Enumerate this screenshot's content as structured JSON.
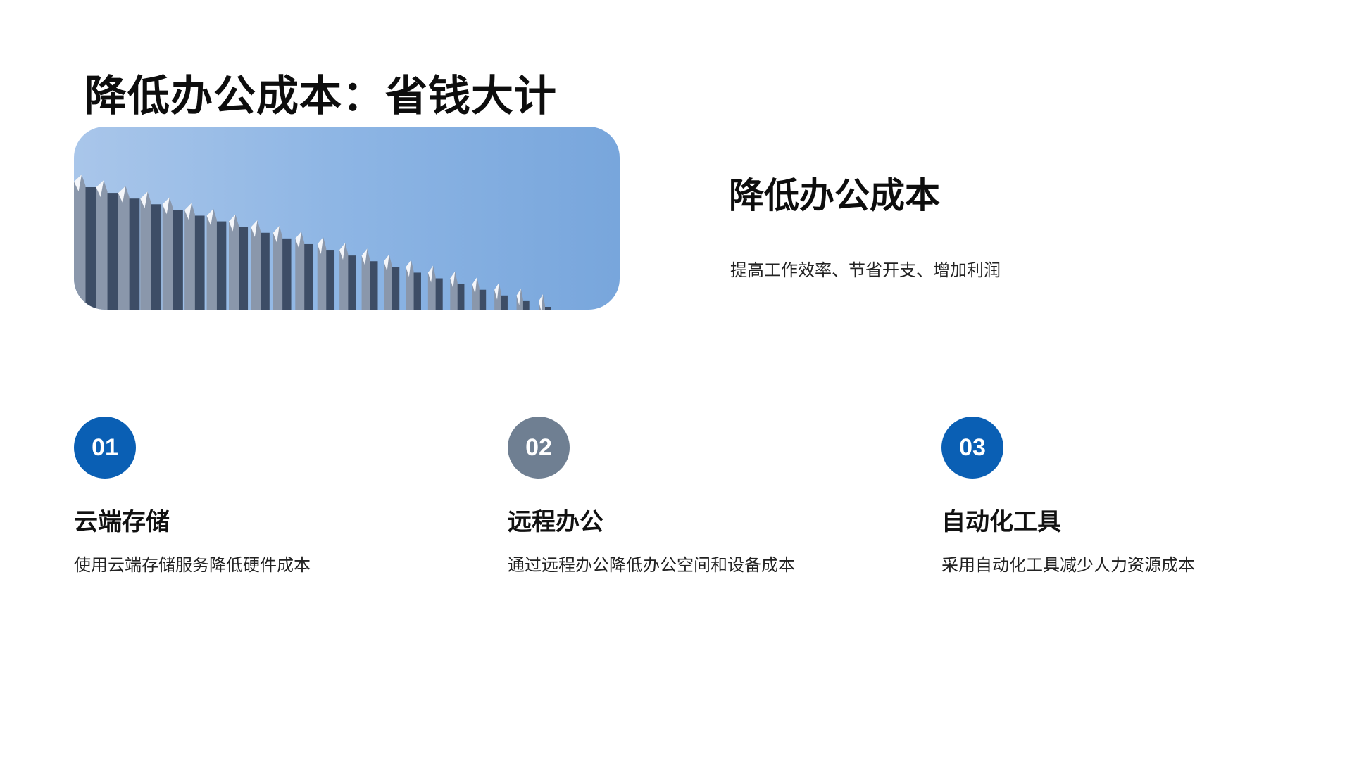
{
  "slide": {
    "title": "降低办公成本：省钱大计",
    "section_title": "降低办公成本",
    "section_subtitle": "提高工作效率、节省开支、增加利润"
  },
  "colors": {
    "accent_blue": "#0a5fb4",
    "accent_gray": "#6f7f92"
  },
  "features": [
    {
      "number": "01",
      "title": "云端存储",
      "description": "使用云端存储服务降低硬件成本",
      "badge_color": "#0a5fb4"
    },
    {
      "number": "02",
      "title": "远程办公",
      "description": "通过远程办公降低办公空间和设备成本",
      "badge_color": "#6f7f92"
    },
    {
      "number": "03",
      "title": "自动化工具",
      "description": "采用自动化工具减少人力资源成本",
      "badge_color": "#0a5fb4"
    }
  ]
}
